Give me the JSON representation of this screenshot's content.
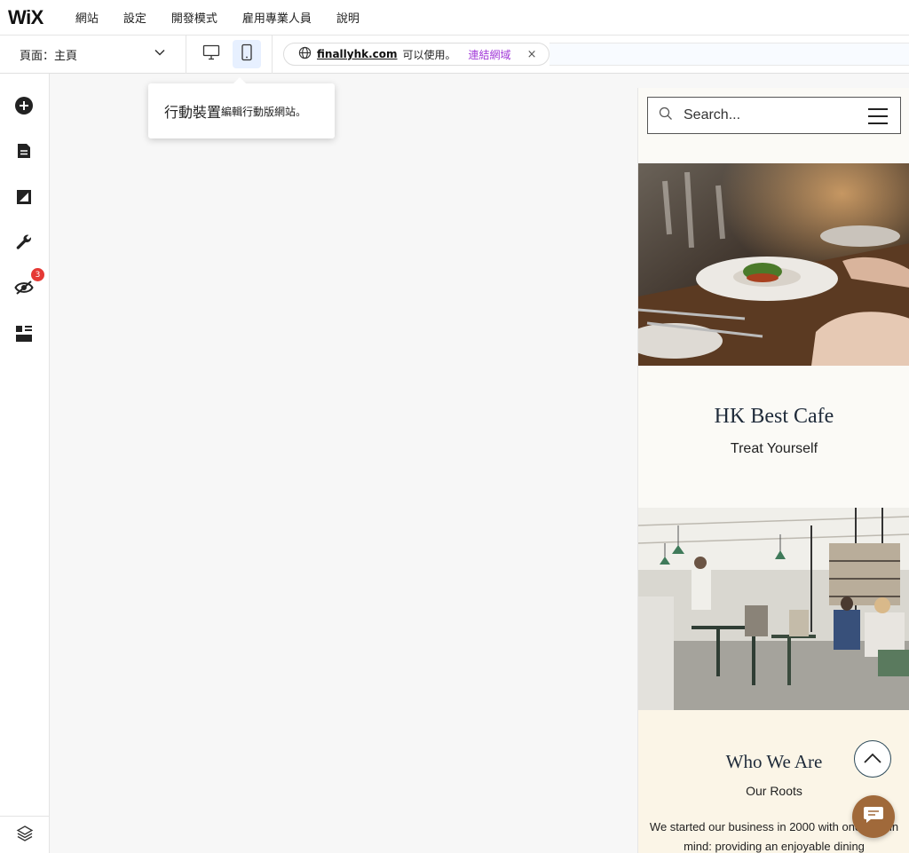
{
  "app": {
    "logo": "WiX"
  },
  "menu": [
    "網站",
    "設定",
    "開發模式",
    "雇用專業人員",
    "說明"
  ],
  "page_select": {
    "label": "頁面：",
    "value": "主頁"
  },
  "domain": {
    "name": "finallyhk.com",
    "status": "可以使用。",
    "connect": "連結網域",
    "close": "×"
  },
  "tooltip": {
    "title": "行動裝置",
    "desc": "編輯行動版網站。"
  },
  "sidebar": {
    "badge_count": "3"
  },
  "mobile_site": {
    "search_placeholder": "Search...",
    "hero_title": "HK Best Cafe",
    "hero_tagline": "Treat Yourself",
    "about_title": "Who We Are",
    "about_subtitle": "Our Roots",
    "about_body": "We started our business in 2000 with one goal in mind: providing an enjoyable dining"
  },
  "icons": [
    "plus-icon",
    "pages-icon",
    "design-icon",
    "wrench-icon",
    "hidden-icon",
    "apps-icon",
    "layers-icon",
    "desktop-icon",
    "mobile-icon",
    "globe-icon",
    "chevron-down-icon",
    "search-icon",
    "menu-icon",
    "chevron-up-icon",
    "chat-icon"
  ]
}
